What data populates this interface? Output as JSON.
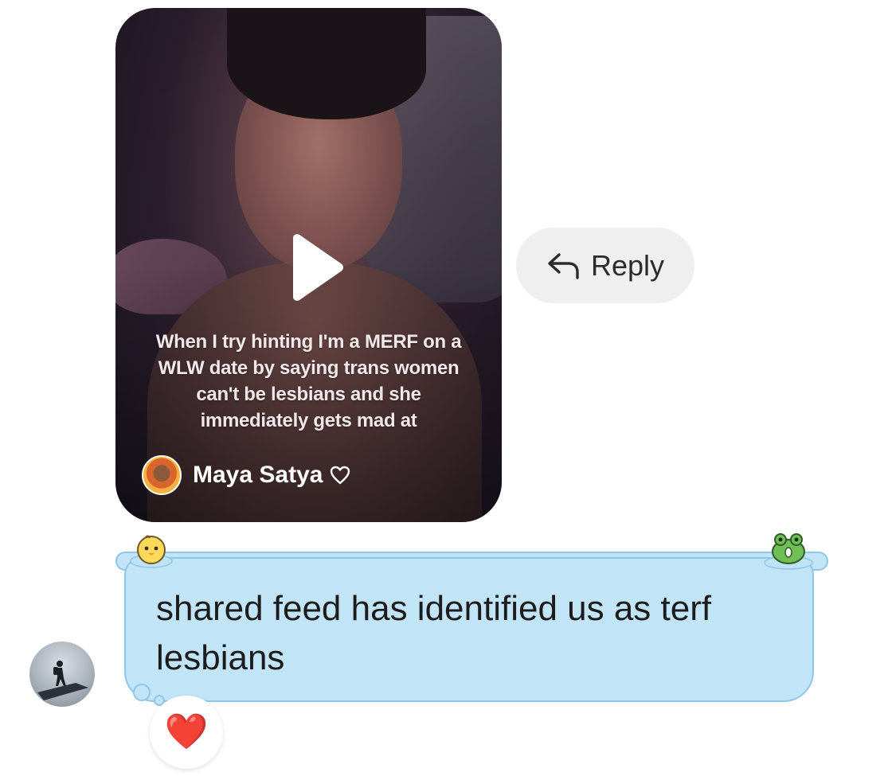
{
  "shared_post": {
    "caption": "When I try hinting I'm a MERF on a WLW date by saying trans women can't be lesbians and she immediately gets mad at",
    "creator_name": "Maya Satya",
    "creator_icon": "heart-outline-icon",
    "play_icon": "play-icon"
  },
  "reply": {
    "label": "Reply",
    "icon": "reply-arrow-icon"
  },
  "message": {
    "text": "shared feed has identified us as terf lesbians",
    "bubble_color": "#c2e4f7",
    "border_color": "#8ec6e7",
    "stickers": [
      "chick-sticker",
      "frog-sticker"
    ]
  },
  "reaction": {
    "emoji": "❤️"
  },
  "sender": {
    "avatar": "avatar"
  }
}
